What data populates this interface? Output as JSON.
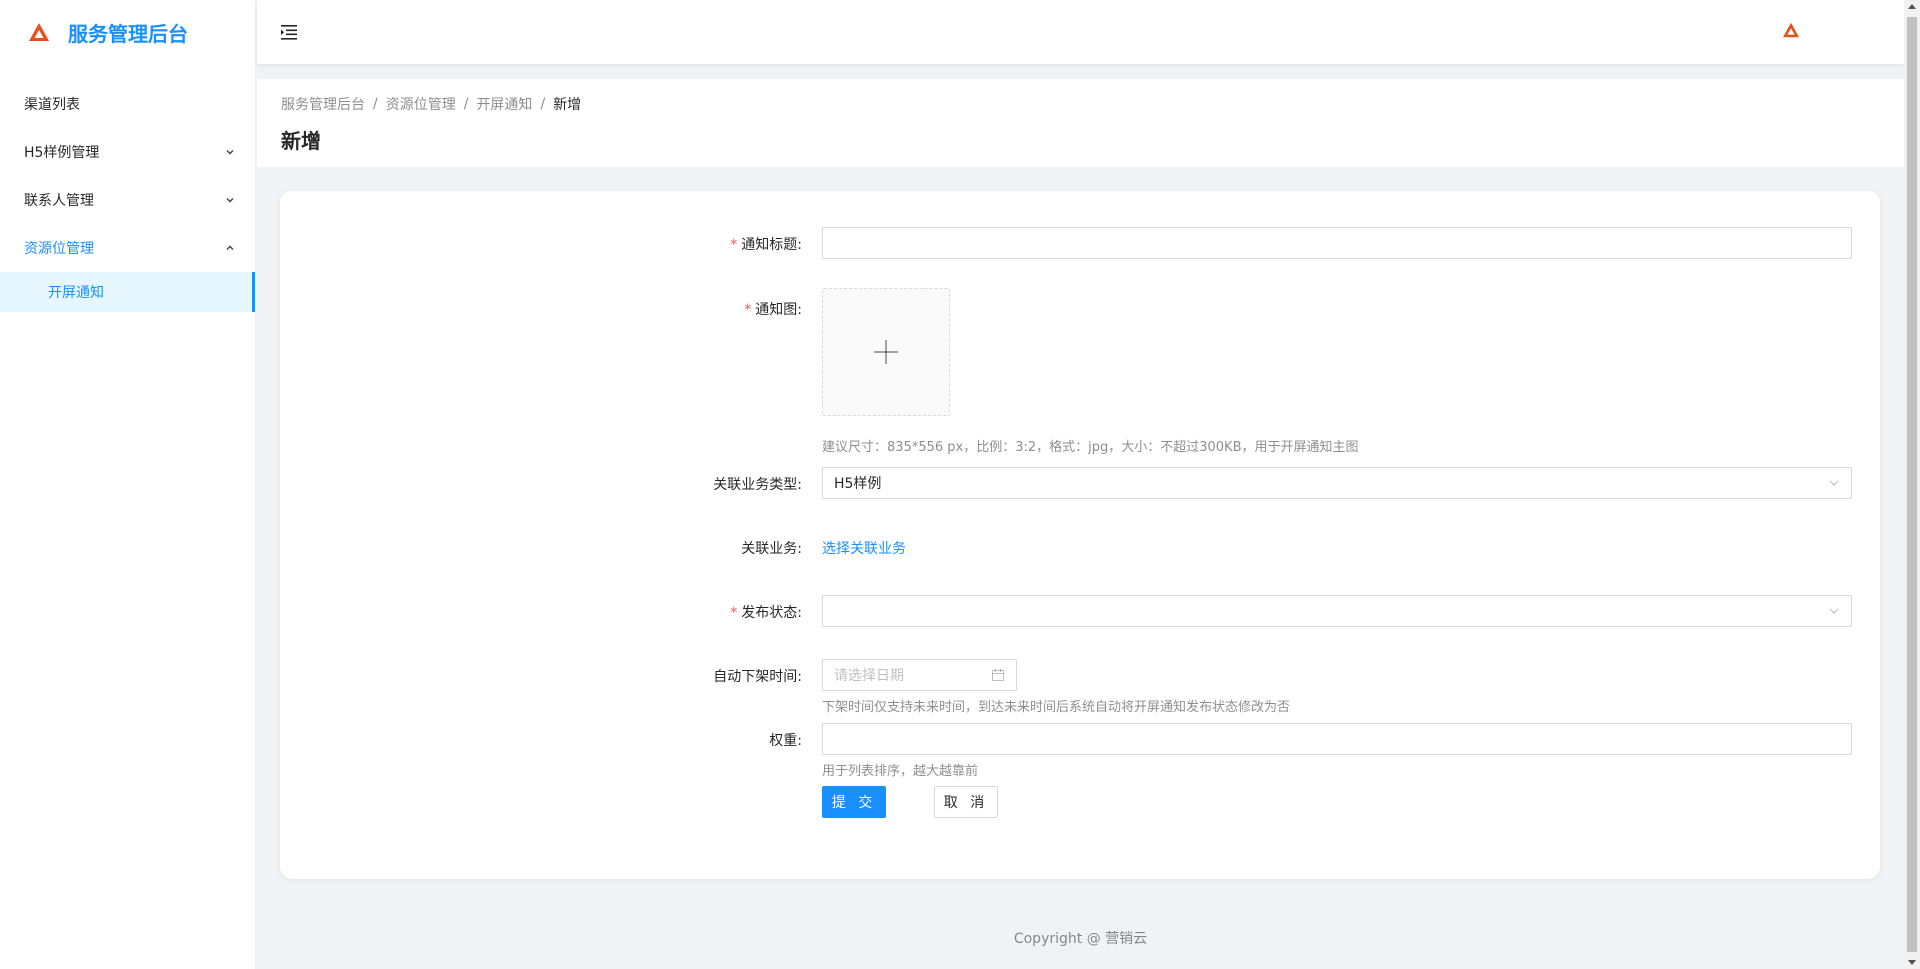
{
  "app": {
    "title": "服务管理后台",
    "logo_icon": "triangle-logo-icon",
    "brand_color": "#1890ff",
    "logo_color": "#e8501a"
  },
  "sidebar": {
    "items": [
      {
        "label": "渠道列表",
        "has_children": false
      },
      {
        "label": "H5样例管理",
        "has_children": true,
        "expanded": false
      },
      {
        "label": "联系人管理",
        "has_children": true,
        "expanded": false
      },
      {
        "label": "资源位管理",
        "has_children": true,
        "expanded": true,
        "children": [
          {
            "label": "开屏通知",
            "selected": true
          }
        ]
      }
    ]
  },
  "header": {
    "fold_icon": "menu-fold-icon"
  },
  "breadcrumb": [
    "服务管理后台",
    "资源位管理",
    "开屏通知",
    "新增"
  ],
  "page": {
    "title": "新增"
  },
  "form": {
    "title": {
      "label": "通知标题",
      "required": true,
      "value": ""
    },
    "image": {
      "label": "通知图",
      "required": true,
      "hint": "建议尺寸：835*556 px，比例：3:2，格式：jpg，大小：不超过300KB，用于开屏通知主图"
    },
    "biz_type": {
      "label": "关联业务类型",
      "required": false,
      "value": "H5样例"
    },
    "biz": {
      "label": "关联业务",
      "required": false,
      "link": "选择关联业务"
    },
    "status": {
      "label": "发布状态",
      "required": true,
      "value": ""
    },
    "offline_time": {
      "label": "自动下架时间",
      "required": false,
      "placeholder": "请选择日期",
      "hint": "下架时间仅支持未来时间，到达未来时间后系统自动将开屏通知发布状态修改为否"
    },
    "weight": {
      "label": "权重",
      "required": false,
      "value": "",
      "hint": "用于列表排序，越大越靠前"
    },
    "submit_label": "提 交",
    "cancel_label": "取 消"
  },
  "footer": {
    "copyright": "Copyright @ 营销云"
  }
}
